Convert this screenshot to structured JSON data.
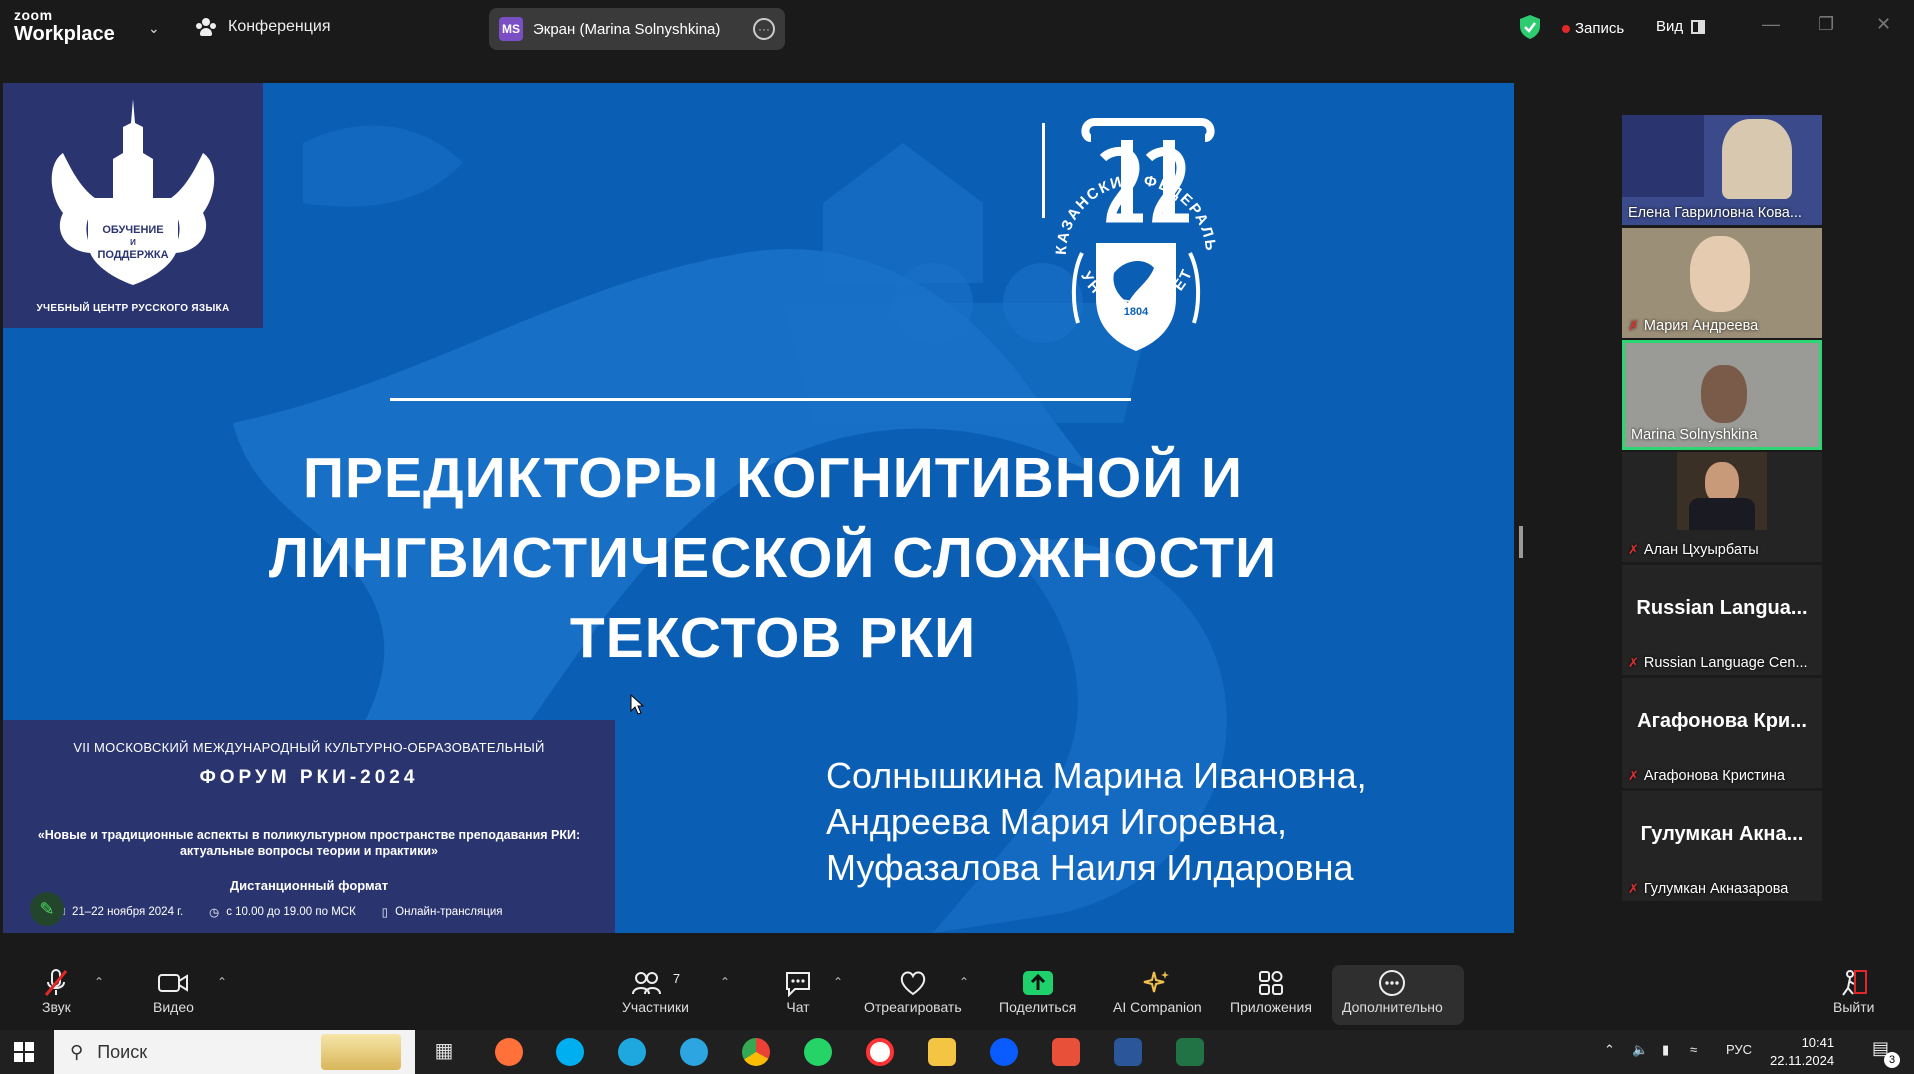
{
  "topbar": {
    "brand_small": "zoom",
    "brand_big": "Workplace",
    "meeting_label": "Конференция",
    "share_badge": "MS",
    "share_label": "Экран (Marina Solnyshkina)",
    "record_label": "Запись",
    "view_label": "Вид",
    "colors": {
      "record_dot": "#e02828",
      "shield": "#2ecc71",
      "badge": "#7b4fc4"
    }
  },
  "slide": {
    "logo_top_text": [
      "ОБУЧЕНИЕ",
      "И",
      "ПОДДЕРЖКА"
    ],
    "logo_caption": "УЧЕБНЫЙ ЦЕНТР РУССКОГО ЯЗЫКА",
    "kfu_arc_top": "КАЗАНСКИЙ ФЕДЕРАЛЬНЫЙ",
    "kfu_arc_bottom": "УНИВЕРСИТЕТ",
    "kfu_year": "1804",
    "title_lines": [
      "ПРЕДИКТОРЫ КОГНИТИВНОЙ И",
      "ЛИНГВИСТИЧЕСКОЙ СЛОЖНОСТИ",
      "ТЕКСТОВ РКИ"
    ],
    "authors": [
      "Солнышкина Марина Ивановна,",
      "Андреева Мария Игоревна,",
      "Муфазалова Наиля Илдаровна"
    ],
    "forum": {
      "top": "VII МОСКОВСКИЙ МЕЖДУНАРОДНЫЙ КУЛЬТУРНО-ОБРАЗОВАТЕЛЬНЫЙ",
      "name": "ФОРУМ РКИ-2024",
      "theme_line1": "«Новые и традиционные аспекты в поликультурном пространстве преподавания РКИ:",
      "theme_line2": "актуальные вопросы теории и практики»",
      "format": "Дистанционный формат",
      "dates": "21–22 ноября 2024 г.",
      "time": "с 10.00 до 19.00 по МСК",
      "broadcast": "Онлайн-трансляция"
    },
    "colors": {
      "background": "#0a5fb4",
      "panel": "#2a3570"
    }
  },
  "participants": [
    {
      "name": "Елена Гавриловна Кова...",
      "video": true,
      "muted": false
    },
    {
      "name": "Мария Андреева",
      "video": true,
      "muted": true
    },
    {
      "name": "Marina Solnyshkina",
      "video": true,
      "muted": false,
      "active_speaker": true
    },
    {
      "name": "Алан Цхуырбаты",
      "video": true,
      "muted": true
    },
    {
      "name": "Russian Language Cen...",
      "big_label": "Russian Langua...",
      "video": false,
      "muted": true
    },
    {
      "name": "Агафонова Кристина",
      "big_label": "Агафонова Кри...",
      "video": false,
      "muted": true
    },
    {
      "name": "Гулумкан Акназарова",
      "big_label": "Гулумкан Акна...",
      "video": false,
      "muted": true
    }
  ],
  "toolbar": {
    "audio": "Звук",
    "video": "Видео",
    "participants": "Участники",
    "participants_count": "7",
    "chat": "Чат",
    "react": "Отреагировать",
    "share": "Поделиться",
    "ai": "AI Companion",
    "apps": "Приложения",
    "more": "Дополнительно",
    "leave": "Выйти",
    "colors": {
      "share_green": "#1fd16a",
      "leave_red": "#e02828",
      "ai_gold": "#f2c14e"
    }
  },
  "taskbar": {
    "search_placeholder": "Поиск",
    "lang": "РУС",
    "time": "10:41",
    "date": "22.11.2024",
    "notif_count": "3"
  }
}
